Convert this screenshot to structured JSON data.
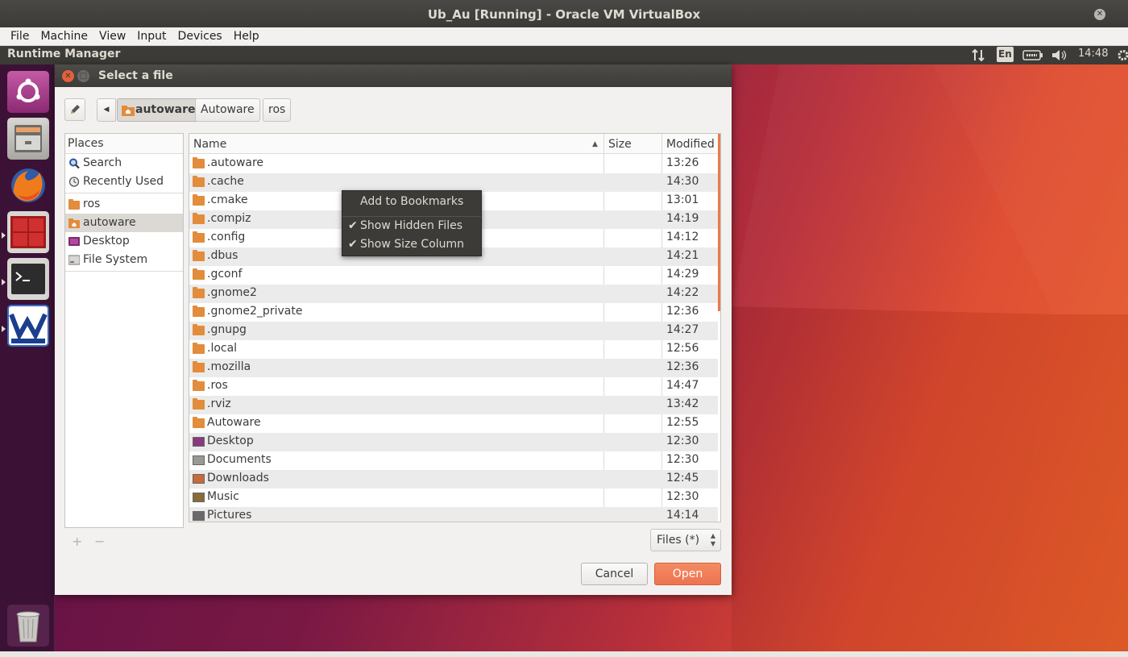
{
  "window": {
    "title": "Ub_Au [Running] - Oracle VM VirtualBox",
    "menu": [
      "File",
      "Machine",
      "View",
      "Input",
      "Devices",
      "Help"
    ]
  },
  "guest_panel": {
    "app_name": "Runtime Manager",
    "keyboard": "En",
    "clock": "14:48"
  },
  "dialog": {
    "title": "Select a file",
    "path": [
      "autoware",
      "Autoware",
      "ros"
    ],
    "places_header": "Places",
    "places": [
      {
        "label": "Search",
        "icon": "search-icon"
      },
      {
        "label": "Recently Used",
        "icon": "clock-icon"
      },
      {
        "label": "ros",
        "icon": "folder-icon"
      },
      {
        "label": "autoware",
        "icon": "home-folder-icon",
        "selected": true
      },
      {
        "label": "Desktop",
        "icon": "desktop-icon"
      },
      {
        "label": "File System",
        "icon": "drive-icon"
      }
    ],
    "columns": {
      "name": "Name",
      "size": "Size",
      "modified": "Modified"
    },
    "files": [
      {
        "name": ".autoware",
        "modified": "13:26",
        "icon": "folder-icon"
      },
      {
        "name": ".cache",
        "modified": "14:30",
        "icon": "folder-icon"
      },
      {
        "name": ".cmake",
        "modified": "13:01",
        "icon": "folder-icon"
      },
      {
        "name": ".compiz",
        "modified": "14:19",
        "icon": "folder-icon"
      },
      {
        "name": ".config",
        "modified": "14:12",
        "icon": "folder-icon"
      },
      {
        "name": ".dbus",
        "modified": "14:21",
        "icon": "folder-icon"
      },
      {
        "name": ".gconf",
        "modified": "14:29",
        "icon": "folder-icon"
      },
      {
        "name": ".gnome2",
        "modified": "14:22",
        "icon": "folder-icon"
      },
      {
        "name": ".gnome2_private",
        "modified": "12:36",
        "icon": "folder-icon"
      },
      {
        "name": ".gnupg",
        "modified": "14:27",
        "icon": "folder-icon"
      },
      {
        "name": ".local",
        "modified": "12:56",
        "icon": "folder-icon"
      },
      {
        "name": ".mozilla",
        "modified": "12:36",
        "icon": "folder-icon"
      },
      {
        "name": ".ros",
        "modified": "14:47",
        "icon": "folder-icon"
      },
      {
        "name": ".rviz",
        "modified": "13:42",
        "icon": "folder-icon"
      },
      {
        "name": "Autoware",
        "modified": "12:55",
        "icon": "folder-icon"
      },
      {
        "name": "Desktop",
        "modified": "12:30",
        "icon": "desktop-icon"
      },
      {
        "name": "Documents",
        "modified": "12:30",
        "icon": "documents-icon"
      },
      {
        "name": "Downloads",
        "modified": "12:45",
        "icon": "downloads-icon"
      },
      {
        "name": "Music",
        "modified": "12:30",
        "icon": "music-icon"
      },
      {
        "name": "Pictures",
        "modified": "14:14",
        "icon": "pictures-icon"
      }
    ],
    "context_menu": {
      "add_bookmark": "Add to Bookmarks",
      "show_hidden": "Show Hidden Files",
      "show_size": "Show Size Column"
    },
    "filter": "Files (*)",
    "cancel": "Cancel",
    "open": "Open"
  },
  "colors": {
    "accent": "#ed7450",
    "panel": "#3c3b37",
    "folder": "#e28c3c"
  }
}
